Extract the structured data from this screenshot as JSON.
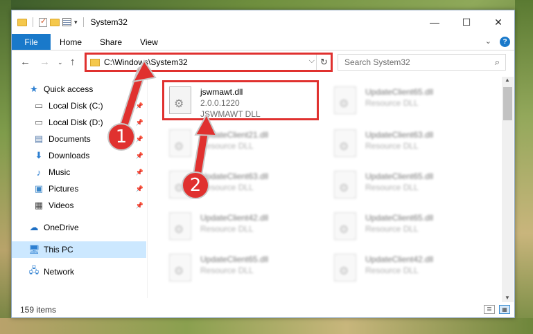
{
  "window": {
    "title": "System32",
    "controls": {
      "minimize": "—",
      "maximize": "☐",
      "close": "✕"
    }
  },
  "ribbon": {
    "file": "File",
    "tabs": [
      "Home",
      "Share",
      "View"
    ]
  },
  "address": {
    "path": "C:\\Windows\\System32",
    "search_placeholder": "Search System32"
  },
  "sidebar": {
    "items": [
      {
        "label": "Quick access",
        "icon": "star-icon",
        "pinned": false
      },
      {
        "label": "Local Disk (C:)",
        "icon": "drive-icon",
        "pinned": true
      },
      {
        "label": "Local Disk (D:)",
        "icon": "drive-icon",
        "pinned": true
      },
      {
        "label": "Documents",
        "icon": "documents-icon",
        "pinned": true
      },
      {
        "label": "Downloads",
        "icon": "download-icon",
        "pinned": true
      },
      {
        "label": "Music",
        "icon": "music-icon",
        "pinned": true
      },
      {
        "label": "Pictures",
        "icon": "pictures-icon",
        "pinned": true
      },
      {
        "label": "Videos",
        "icon": "videos-icon",
        "pinned": true
      },
      {
        "label": "OneDrive",
        "icon": "cloud-icon",
        "pinned": false
      },
      {
        "label": "This PC",
        "icon": "computer-icon",
        "pinned": false,
        "selected": true
      },
      {
        "label": "Network",
        "icon": "network-icon",
        "pinned": false
      }
    ]
  },
  "files": {
    "highlighted": {
      "name": "jswmawt.dll",
      "version": "2.0.0.1220",
      "description": "JSWMAWT DLL"
    },
    "column1": [
      {
        "name": "UpdateClient21.dll",
        "description": "Resource DLL"
      },
      {
        "name": "UpdateClient63.dll",
        "description": "Resource DLL"
      },
      {
        "name": "UpdateClient42.dll",
        "description": "Resource DLL"
      },
      {
        "name": "UpdateClient65.dll",
        "description": "Resource DLL"
      }
    ],
    "column2": [
      {
        "name": "UpdateClient65.dll",
        "description": "Resource DLL"
      },
      {
        "name": "UpdateClient63.dll",
        "description": "Resource DLL"
      },
      {
        "name": "UpdateClient65.dll",
        "description": "Resource DLL"
      },
      {
        "name": "UpdateClient65.dll",
        "description": "Resource DLL"
      },
      {
        "name": "UpdateClient42.dll",
        "description": "Resource DLL"
      }
    ]
  },
  "status": {
    "items": "159 items"
  },
  "annotations": {
    "step1": "1",
    "step2": "2",
    "color": "#e0312f"
  }
}
